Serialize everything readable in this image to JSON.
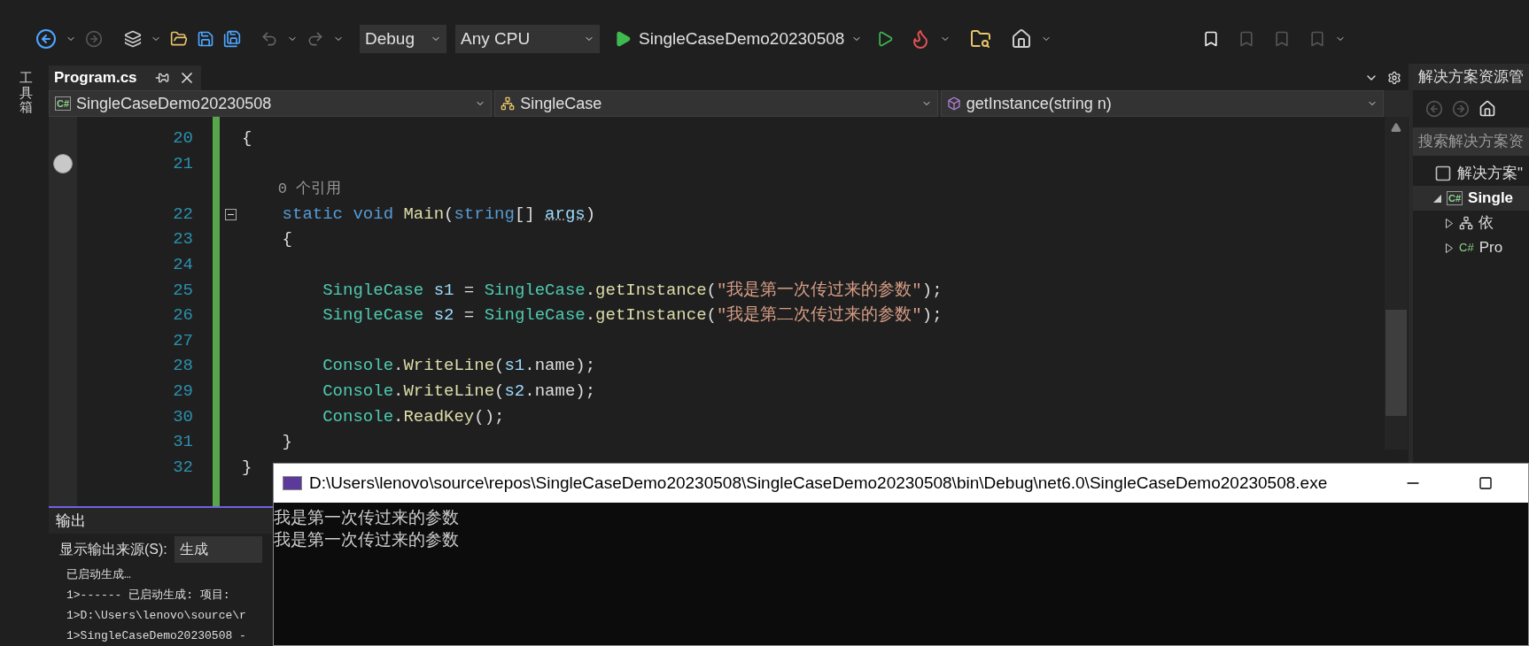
{
  "toolbar": {
    "configuration": "Debug",
    "platform": "Any CPU",
    "startup_target": "SingleCaseDemo20230508"
  },
  "toolbox": {
    "label": "工具箱"
  },
  "editor": {
    "tabs": [
      {
        "label": "Program.cs",
        "selected": true
      }
    ],
    "nav": [
      {
        "kind": "project",
        "icon_text": "C#",
        "label": "SingleCaseDemo20230508"
      },
      {
        "kind": "class",
        "label": "SingleCase"
      },
      {
        "kind": "method",
        "label": "getInstance(string n)"
      }
    ],
    "lines": [
      {
        "kind": "code",
        "number": "20",
        "breakpoint": false,
        "collapsible": false,
        "tokens": [
          {
            "kind": "plain",
            "text": "{"
          }
        ]
      },
      {
        "kind": "code",
        "number": "21",
        "breakpoint": true,
        "collapsible": false
      },
      {
        "kind": "codelens",
        "text": "    0 个引用"
      },
      {
        "kind": "code",
        "number": "22",
        "breakpoint": false,
        "collapsible": true,
        "tokens": [
          {
            "kind": "keyword",
            "text": "    static "
          },
          {
            "kind": "keyword",
            "text": "void "
          },
          {
            "kind": "method",
            "text": "Main"
          },
          {
            "kind": "plain",
            "text": "("
          },
          {
            "kind": "keyword",
            "text": "string"
          },
          {
            "kind": "plain",
            "text": "[] "
          },
          {
            "kind": "unused",
            "text": "args"
          },
          {
            "kind": "plain",
            "text": ")"
          }
        ]
      },
      {
        "kind": "code",
        "number": "23",
        "breakpoint": false,
        "collapsible": false,
        "tokens": [
          {
            "kind": "plain",
            "text": "    {"
          }
        ]
      },
      {
        "kind": "code",
        "number": "24",
        "breakpoint": false,
        "collapsible": false
      },
      {
        "kind": "code",
        "number": "25",
        "breakpoint": false,
        "collapsible": false,
        "tokens": [
          {
            "kind": "type",
            "text": "        SingleCase "
          },
          {
            "kind": "variable",
            "text": "s1"
          },
          {
            "kind": "plain",
            "text": " = "
          },
          {
            "kind": "type",
            "text": "SingleCase"
          },
          {
            "kind": "plain",
            "text": "."
          },
          {
            "kind": "method",
            "text": "getInstance"
          },
          {
            "kind": "plain",
            "text": "("
          },
          {
            "kind": "string",
            "text": "\"我是第一次传过来的参数\""
          },
          {
            "kind": "plain",
            "text": ");"
          }
        ]
      },
      {
        "kind": "code",
        "number": "26",
        "breakpoint": false,
        "collapsible": false,
        "tokens": [
          {
            "kind": "type",
            "text": "        SingleCase "
          },
          {
            "kind": "variable",
            "text": "s2"
          },
          {
            "kind": "plain",
            "text": " = "
          },
          {
            "kind": "type",
            "text": "SingleCase"
          },
          {
            "kind": "plain",
            "text": "."
          },
          {
            "kind": "method",
            "text": "getInstance"
          },
          {
            "kind": "plain",
            "text": "("
          },
          {
            "kind": "string",
            "text": "\"我是第二次传过来的参数\""
          },
          {
            "kind": "plain",
            "text": ");"
          }
        ]
      },
      {
        "kind": "code",
        "number": "27",
        "breakpoint": false,
        "collapsible": false
      },
      {
        "kind": "code",
        "number": "28",
        "breakpoint": false,
        "collapsible": false,
        "tokens": [
          {
            "kind": "type",
            "text": "        Console"
          },
          {
            "kind": "plain",
            "text": "."
          },
          {
            "kind": "method",
            "text": "WriteLine"
          },
          {
            "kind": "plain",
            "text": "("
          },
          {
            "kind": "variable",
            "text": "s1"
          },
          {
            "kind": "plain",
            "text": ".name);"
          }
        ]
      },
      {
        "kind": "code",
        "number": "29",
        "breakpoint": false,
        "collapsible": false,
        "tokens": [
          {
            "kind": "type",
            "text": "        Console"
          },
          {
            "kind": "plain",
            "text": "."
          },
          {
            "kind": "method",
            "text": "WriteLine"
          },
          {
            "kind": "plain",
            "text": "("
          },
          {
            "kind": "variable",
            "text": "s2"
          },
          {
            "kind": "plain",
            "text": ".name);"
          }
        ]
      },
      {
        "kind": "code",
        "number": "30",
        "breakpoint": false,
        "collapsible": false,
        "tokens": [
          {
            "kind": "type",
            "text": "        Console"
          },
          {
            "kind": "plain",
            "text": "."
          },
          {
            "kind": "method",
            "text": "ReadKey"
          },
          {
            "kind": "plain",
            "text": "();"
          }
        ]
      },
      {
        "kind": "code",
        "number": "31",
        "breakpoint": false,
        "collapsible": false,
        "tokens": [
          {
            "kind": "plain",
            "text": "    }"
          }
        ]
      },
      {
        "kind": "code",
        "number": "32",
        "breakpoint": false,
        "collapsible": false,
        "tokens": [
          {
            "kind": "plain",
            "text": "}"
          }
        ]
      }
    ]
  },
  "output": {
    "title": "输出",
    "source_label": "显示输出来源(S):",
    "source_value": "生成",
    "lines": [
      "已启动生成…",
      "1>------ 已启动生成: 项目:",
      "1>D:\\Users\\lenovo\\source\\r",
      "1>SingleCaseDemo20230508 -"
    ]
  },
  "solution_explorer": {
    "title": "解决方案资源管",
    "search": {
      "placeholder": "搜索解决方案资"
    },
    "tree": [
      {
        "kind": "solution",
        "label": "解决方案\"",
        "selected": false,
        "children": [
          {
            "kind": "project",
            "icon_text": "C#",
            "label": "Single",
            "selected": true,
            "expanded": true,
            "children": [
              {
                "kind": "dependencies",
                "label": "依",
                "selected": false,
                "expanded": false
              },
              {
                "kind": "csharp",
                "icon_text": "C#",
                "label": "Pro",
                "selected": false,
                "expanded": false
              }
            ]
          }
        ]
      }
    ]
  },
  "console": {
    "title": "D:\\Users\\lenovo\\source\\repos\\SingleCaseDemo20230508\\SingleCaseDemo20230508\\bin\\Debug\\net6.0\\SingleCaseDemo20230508.exe",
    "lines": [
      "我是第一次传过来的参数",
      "我是第一次传过来的参数"
    ]
  }
}
